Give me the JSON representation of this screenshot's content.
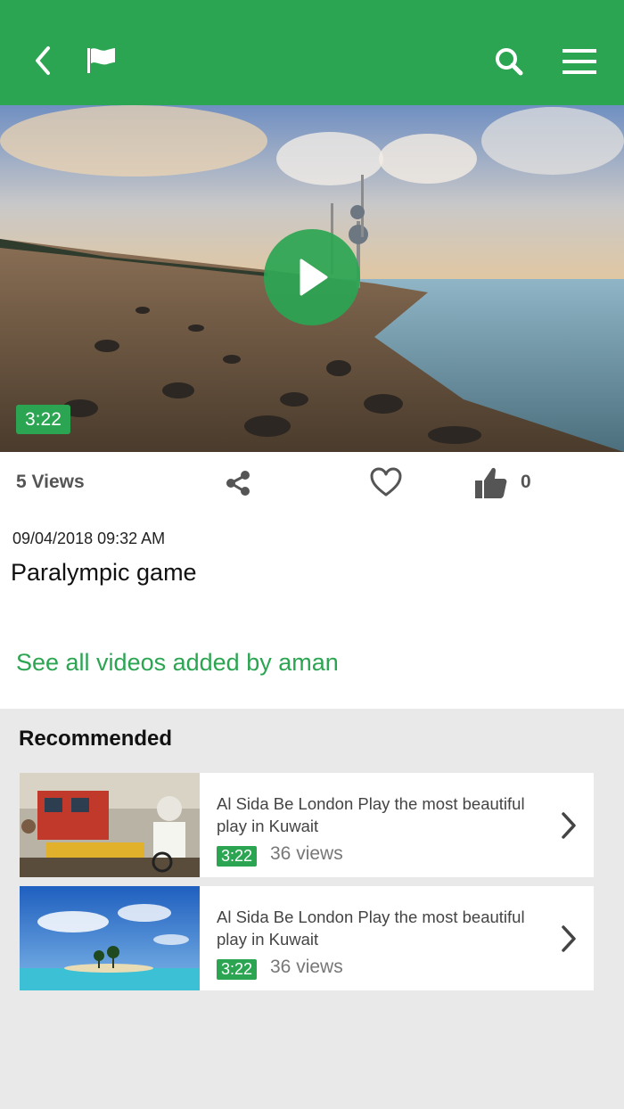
{
  "header": {
    "background": "#2ba552",
    "icons": [
      "back-icon",
      "flag-icon",
      "search-icon",
      "hamburger-menu-icon"
    ]
  },
  "video": {
    "duration": "3:22",
    "play_icon": "play-icon"
  },
  "stats": {
    "views": "5 Views",
    "likes": "0",
    "icons": [
      "share-icon",
      "heart-icon",
      "thumbs-up-icon"
    ]
  },
  "post": {
    "date": "09/04/2018 09:32 AM",
    "title": "Paralympic game",
    "see_all_link": "See all videos added by aman"
  },
  "recommended": {
    "heading": "Recommended",
    "items": [
      {
        "title": "Al Sida Be London Play the most beautiful play in Kuwait",
        "duration": "3:22",
        "views": "36 views"
      },
      {
        "title": "Al Sida Be London Play the most beautiful play in Kuwait",
        "duration": "3:22",
        "views": "36 views"
      }
    ]
  },
  "colors": {
    "accent": "#2ba552",
    "section_bg": "#e9e9e9"
  }
}
